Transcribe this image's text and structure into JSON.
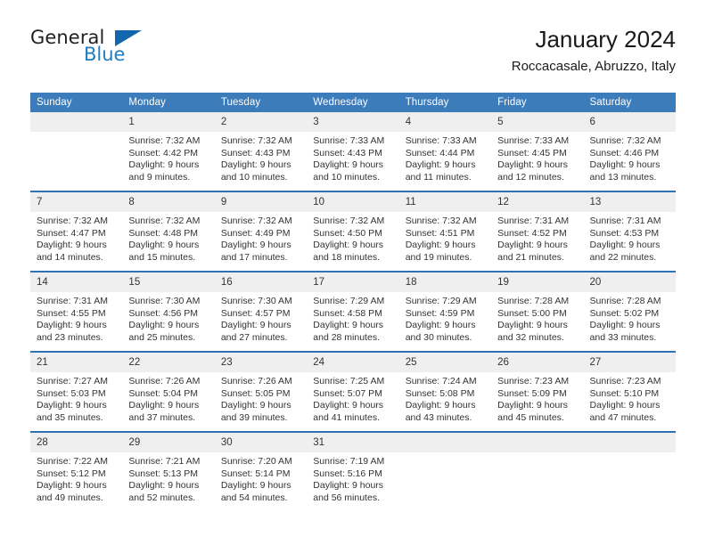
{
  "brand": {
    "word1": "General",
    "word2": "Blue",
    "triangle_color": "#1266ad",
    "blue_color": "#1f7dc4"
  },
  "header": {
    "title": "January 2024",
    "subtitle": "Roccacasale, Abruzzo, Italy"
  },
  "colors": {
    "header_blue": "#3c7cba",
    "row_separator": "#2f72b3",
    "daynum_band": "#efefef"
  },
  "calendar": {
    "weekday_headers": [
      "Sunday",
      "Monday",
      "Tuesday",
      "Wednesday",
      "Thursday",
      "Friday",
      "Saturday"
    ],
    "weeks": [
      [
        {
          "day": "",
          "empty": true
        },
        {
          "day": "1",
          "sunrise": "Sunrise: 7:32 AM",
          "sunset": "Sunset: 4:42 PM",
          "daylight1": "Daylight: 9 hours",
          "daylight2": "and 9 minutes."
        },
        {
          "day": "2",
          "sunrise": "Sunrise: 7:32 AM",
          "sunset": "Sunset: 4:43 PM",
          "daylight1": "Daylight: 9 hours",
          "daylight2": "and 10 minutes."
        },
        {
          "day": "3",
          "sunrise": "Sunrise: 7:33 AM",
          "sunset": "Sunset: 4:43 PM",
          "daylight1": "Daylight: 9 hours",
          "daylight2": "and 10 minutes."
        },
        {
          "day": "4",
          "sunrise": "Sunrise: 7:33 AM",
          "sunset": "Sunset: 4:44 PM",
          "daylight1": "Daylight: 9 hours",
          "daylight2": "and 11 minutes."
        },
        {
          "day": "5",
          "sunrise": "Sunrise: 7:33 AM",
          "sunset": "Sunset: 4:45 PM",
          "daylight1": "Daylight: 9 hours",
          "daylight2": "and 12 minutes."
        },
        {
          "day": "6",
          "sunrise": "Sunrise: 7:32 AM",
          "sunset": "Sunset: 4:46 PM",
          "daylight1": "Daylight: 9 hours",
          "daylight2": "and 13 minutes."
        }
      ],
      [
        {
          "day": "7",
          "sunrise": "Sunrise: 7:32 AM",
          "sunset": "Sunset: 4:47 PM",
          "daylight1": "Daylight: 9 hours",
          "daylight2": "and 14 minutes."
        },
        {
          "day": "8",
          "sunrise": "Sunrise: 7:32 AM",
          "sunset": "Sunset: 4:48 PM",
          "daylight1": "Daylight: 9 hours",
          "daylight2": "and 15 minutes."
        },
        {
          "day": "9",
          "sunrise": "Sunrise: 7:32 AM",
          "sunset": "Sunset: 4:49 PM",
          "daylight1": "Daylight: 9 hours",
          "daylight2": "and 17 minutes."
        },
        {
          "day": "10",
          "sunrise": "Sunrise: 7:32 AM",
          "sunset": "Sunset: 4:50 PM",
          "daylight1": "Daylight: 9 hours",
          "daylight2": "and 18 minutes."
        },
        {
          "day": "11",
          "sunrise": "Sunrise: 7:32 AM",
          "sunset": "Sunset: 4:51 PM",
          "daylight1": "Daylight: 9 hours",
          "daylight2": "and 19 minutes."
        },
        {
          "day": "12",
          "sunrise": "Sunrise: 7:31 AM",
          "sunset": "Sunset: 4:52 PM",
          "daylight1": "Daylight: 9 hours",
          "daylight2": "and 21 minutes."
        },
        {
          "day": "13",
          "sunrise": "Sunrise: 7:31 AM",
          "sunset": "Sunset: 4:53 PM",
          "daylight1": "Daylight: 9 hours",
          "daylight2": "and 22 minutes."
        }
      ],
      [
        {
          "day": "14",
          "sunrise": "Sunrise: 7:31 AM",
          "sunset": "Sunset: 4:55 PM",
          "daylight1": "Daylight: 9 hours",
          "daylight2": "and 23 minutes."
        },
        {
          "day": "15",
          "sunrise": "Sunrise: 7:30 AM",
          "sunset": "Sunset: 4:56 PM",
          "daylight1": "Daylight: 9 hours",
          "daylight2": "and 25 minutes."
        },
        {
          "day": "16",
          "sunrise": "Sunrise: 7:30 AM",
          "sunset": "Sunset: 4:57 PM",
          "daylight1": "Daylight: 9 hours",
          "daylight2": "and 27 minutes."
        },
        {
          "day": "17",
          "sunrise": "Sunrise: 7:29 AM",
          "sunset": "Sunset: 4:58 PM",
          "daylight1": "Daylight: 9 hours",
          "daylight2": "and 28 minutes."
        },
        {
          "day": "18",
          "sunrise": "Sunrise: 7:29 AM",
          "sunset": "Sunset: 4:59 PM",
          "daylight1": "Daylight: 9 hours",
          "daylight2": "and 30 minutes."
        },
        {
          "day": "19",
          "sunrise": "Sunrise: 7:28 AM",
          "sunset": "Sunset: 5:00 PM",
          "daylight1": "Daylight: 9 hours",
          "daylight2": "and 32 minutes."
        },
        {
          "day": "20",
          "sunrise": "Sunrise: 7:28 AM",
          "sunset": "Sunset: 5:02 PM",
          "daylight1": "Daylight: 9 hours",
          "daylight2": "and 33 minutes."
        }
      ],
      [
        {
          "day": "21",
          "sunrise": "Sunrise: 7:27 AM",
          "sunset": "Sunset: 5:03 PM",
          "daylight1": "Daylight: 9 hours",
          "daylight2": "and 35 minutes."
        },
        {
          "day": "22",
          "sunrise": "Sunrise: 7:26 AM",
          "sunset": "Sunset: 5:04 PM",
          "daylight1": "Daylight: 9 hours",
          "daylight2": "and 37 minutes."
        },
        {
          "day": "23",
          "sunrise": "Sunrise: 7:26 AM",
          "sunset": "Sunset: 5:05 PM",
          "daylight1": "Daylight: 9 hours",
          "daylight2": "and 39 minutes."
        },
        {
          "day": "24",
          "sunrise": "Sunrise: 7:25 AM",
          "sunset": "Sunset: 5:07 PM",
          "daylight1": "Daylight: 9 hours",
          "daylight2": "and 41 minutes."
        },
        {
          "day": "25",
          "sunrise": "Sunrise: 7:24 AM",
          "sunset": "Sunset: 5:08 PM",
          "daylight1": "Daylight: 9 hours",
          "daylight2": "and 43 minutes."
        },
        {
          "day": "26",
          "sunrise": "Sunrise: 7:23 AM",
          "sunset": "Sunset: 5:09 PM",
          "daylight1": "Daylight: 9 hours",
          "daylight2": "and 45 minutes."
        },
        {
          "day": "27",
          "sunrise": "Sunrise: 7:23 AM",
          "sunset": "Sunset: 5:10 PM",
          "daylight1": "Daylight: 9 hours",
          "daylight2": "and 47 minutes."
        }
      ],
      [
        {
          "day": "28",
          "sunrise": "Sunrise: 7:22 AM",
          "sunset": "Sunset: 5:12 PM",
          "daylight1": "Daylight: 9 hours",
          "daylight2": "and 49 minutes."
        },
        {
          "day": "29",
          "sunrise": "Sunrise: 7:21 AM",
          "sunset": "Sunset: 5:13 PM",
          "daylight1": "Daylight: 9 hours",
          "daylight2": "and 52 minutes."
        },
        {
          "day": "30",
          "sunrise": "Sunrise: 7:20 AM",
          "sunset": "Sunset: 5:14 PM",
          "daylight1": "Daylight: 9 hours",
          "daylight2": "and 54 minutes."
        },
        {
          "day": "31",
          "sunrise": "Sunrise: 7:19 AM",
          "sunset": "Sunset: 5:16 PM",
          "daylight1": "Daylight: 9 hours",
          "daylight2": "and 56 minutes."
        },
        {
          "day": "",
          "empty": true
        },
        {
          "day": "",
          "empty": true
        },
        {
          "day": "",
          "empty": true
        }
      ]
    ]
  }
}
